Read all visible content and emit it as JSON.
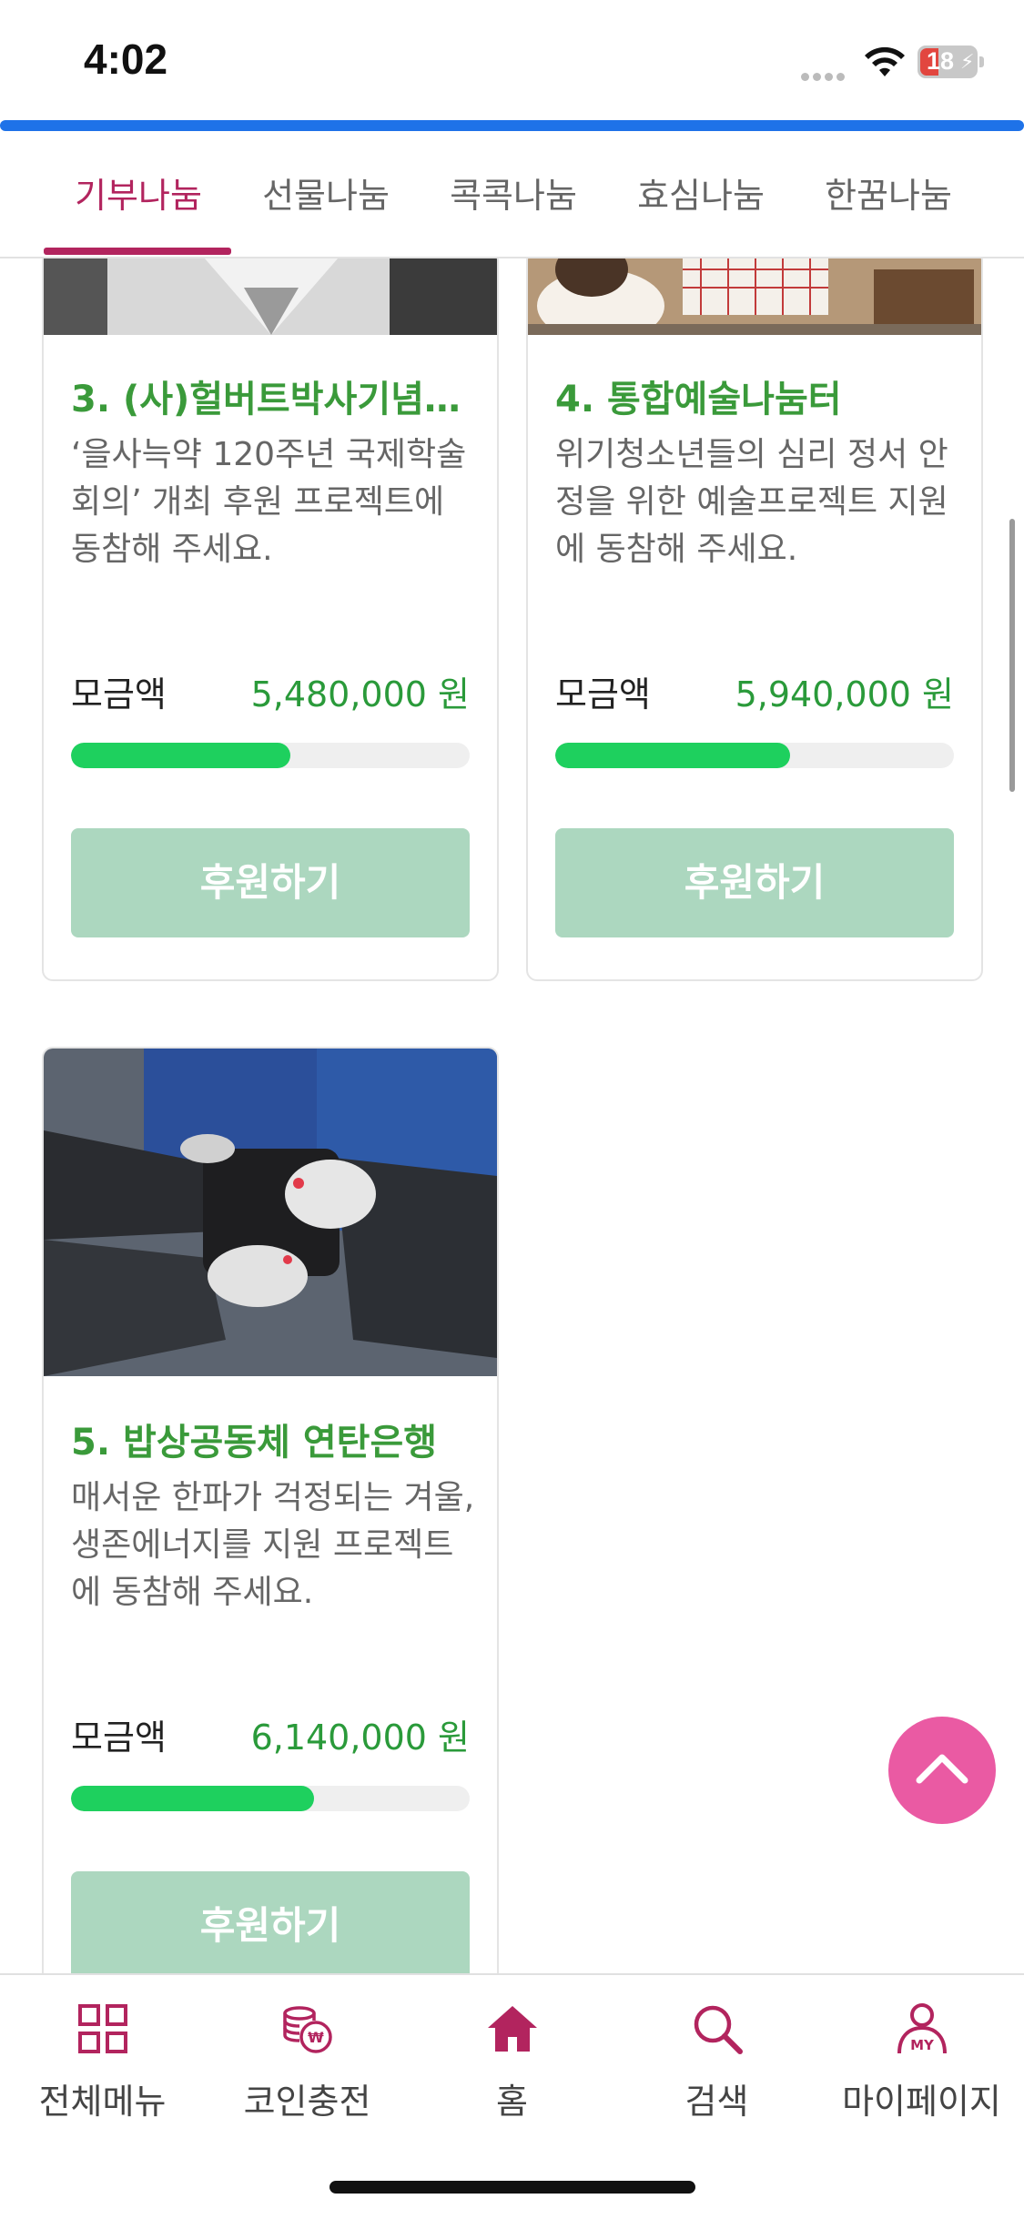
{
  "status_bar": {
    "time": "4:02",
    "battery": "18"
  },
  "tabs": [
    {
      "label": "기부나눔",
      "active": true
    },
    {
      "label": "선물나눔",
      "active": false
    },
    {
      "label": "콕콕나눔",
      "active": false
    },
    {
      "label": "효심나눔",
      "active": false
    },
    {
      "label": "한꿈나눔",
      "active": false
    }
  ],
  "cards": [
    {
      "title": "3. (사)헐버트박사기념…",
      "desc": "‘을사늑약 120주년 국제학술회의’ 개최 후원 프로젝트에 동참해 주세요.",
      "amount_label": "모금액",
      "amount": "5,480,000 원",
      "progress": 0.55,
      "button": "후원하기"
    },
    {
      "title": "4. 통합예술나눔터",
      "desc": "위기청소년들의 심리 정서 안정을 위한 예술프로젝트 지원에 동참해 주세요.",
      "amount_label": "모금액",
      "amount": "5,940,000 원",
      "progress": 0.59,
      "button": "후원하기"
    },
    {
      "title": "5. 밥상공동체 연탄은행",
      "desc": "매서운 한파가 걱정되는 겨울, 생존에너지를 지원 프로젝트에 동참해 주세요.",
      "amount_label": "모금액",
      "amount": "6,140,000 원",
      "progress": 0.61,
      "button": "후원하기"
    }
  ],
  "bottom_nav": [
    {
      "label": "전체메뉴",
      "icon": "grid-icon"
    },
    {
      "label": "코인충전",
      "icon": "coin-icon"
    },
    {
      "label": "홈",
      "icon": "home-icon"
    },
    {
      "label": "검색",
      "icon": "search-icon"
    },
    {
      "label": "마이페이지",
      "icon": "user-icon"
    }
  ],
  "colors": {
    "accent": "#b2245e",
    "progress_fill": "#1ed05e",
    "button_bg": "#acd7bf",
    "title_green": "#3a9a3a",
    "scroll_top": "#ea5aa3",
    "top_bar_blue": "#1e72e8"
  }
}
